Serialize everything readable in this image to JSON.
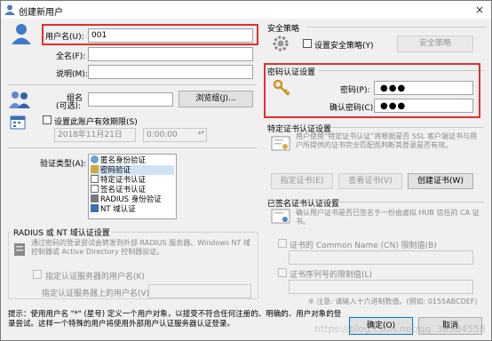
{
  "window": {
    "title": "创建新用户",
    "close_label": "×"
  },
  "user": {
    "username_label": "用户名(U):",
    "username_value": "001",
    "fullname_label": "全名(F):",
    "fullname_value": "",
    "description_label": "说明(M):",
    "description_value": "",
    "group_label_1": "组名",
    "group_label_2": "(可选):",
    "group_value": "",
    "browse_group_button": "浏览组(J)...",
    "expire_checkbox_label": "设置此账户有效期限(S)",
    "expire_date": "2018年11月21日",
    "expire_time": "0:00:00"
  },
  "security_policy": {
    "title": "安全策略",
    "checkbox_label": "设置安全策略(Y)",
    "button_label": "安全策略"
  },
  "password_auth": {
    "title": "密码认证设置",
    "password_label": "密码(P):",
    "password_value": "●●●",
    "confirm_label": "确认密码(C):",
    "confirm_value": "●●●"
  },
  "auth_type": {
    "label": "验证类型(A):",
    "items": [
      {
        "label": "匿名身份验证",
        "selected": false
      },
      {
        "label": "密码验证",
        "selected": true
      },
      {
        "label": "特定证书认证",
        "selected": false
      },
      {
        "label": "签名证书认证",
        "selected": false
      },
      {
        "label": "RADIUS 身份验证",
        "selected": false
      },
      {
        "label": "NT 域认证",
        "selected": false
      }
    ]
  },
  "radius": {
    "title": "RADIUS 或 NT 域认证设置",
    "description": "通过密码的登录尝试会转发到外部 RADIUS 服务器、Windows NT 域控制器或 Active Directory 控制器验证。",
    "checkbox_label": "指定认证服务器的用户名(K)",
    "field_label": "指定认证服务器上的用户名(V):",
    "field_value": ""
  },
  "specific_cert": {
    "title": "特定证书认证设置",
    "description": "用户使用“特定证书认证”将根据是否 SSL 客户端证书与用户所提供的证书完全匹配而判断其登录是否有效。",
    "btn_set": "指定证书(E)",
    "btn_view": "查看证书(V)",
    "btn_create": "创建证书(W)"
  },
  "signed_cert": {
    "title": "已签名证书认证设置",
    "description": "确认用户证书是否已签名于一份由虚拟 HUB 信任的 CA 证书。",
    "cn_label": "证书的 Common Name (CN) 限制值(B)",
    "serial_label": "证书序列号的限制值(L)",
    "note": "※ 注意: 请输入十六进制数值。(例如: 0155ABCDEF)"
  },
  "footer": {
    "hint": "提示：使用用户名 \"*\" (星号) 定义一个用户对象，以接受不符合任何注册的、明确的、用户对象的登录尝试。这样一个特殊的用户将使用外部用户认证服务器认证登录。",
    "ok_button": "确定(O)",
    "cancel_button": "取消"
  },
  "watermark": "https://blog.csdn.net/qq_36584558",
  "colors": {
    "highlight_red": "#e03030",
    "accent_blue": "#0078d7"
  }
}
